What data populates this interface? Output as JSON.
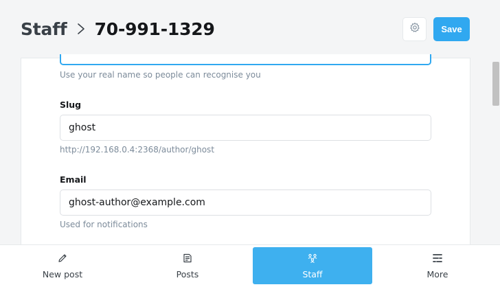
{
  "header": {
    "breadcrumb_root": "Staff",
    "breadcrumb_current": "70-991-1329",
    "save_label": "Save"
  },
  "form": {
    "name_hint": "Use your real name so people can recognise you",
    "slug_label": "Slug",
    "slug_value": "ghost",
    "slug_url": "http://192.168.0.4:2368/author/ghost",
    "email_label": "Email",
    "email_value": "ghost-author@example.com",
    "email_hint": "Used for notifications"
  },
  "bottom_nav": {
    "items": [
      {
        "label": "New post",
        "icon": "pencil-icon"
      },
      {
        "label": "Posts",
        "icon": "posts-icon"
      },
      {
        "label": "Staff",
        "icon": "staff-icon",
        "active": true
      },
      {
        "label": "More",
        "icon": "more-icon"
      }
    ]
  },
  "colors": {
    "accent": "#30a8f0",
    "nav_active": "#3eb0ef",
    "background": "#f4f5f6",
    "hint_text": "#7c8b9a"
  }
}
